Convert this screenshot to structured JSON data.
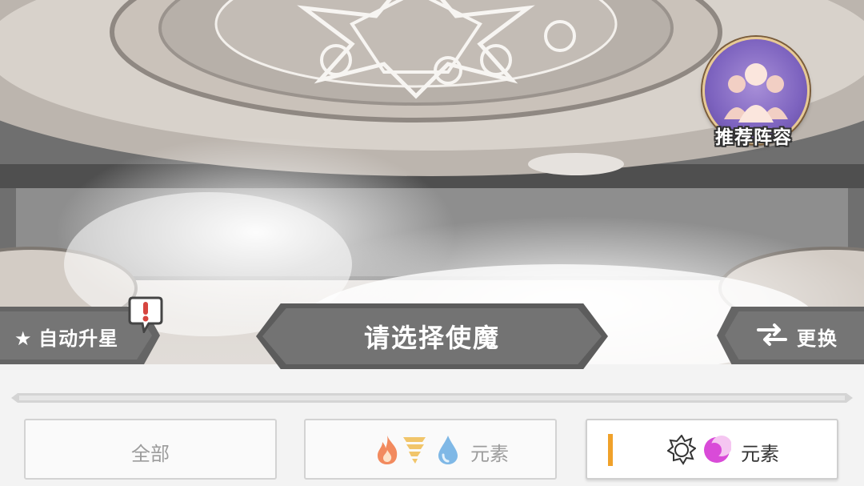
{
  "recommend": {
    "label": "推荐阵容",
    "icon": "team-silhouette-icon"
  },
  "auto_star": {
    "label": "★ 自动升星",
    "alert_icon": "exclamation-icon"
  },
  "title": {
    "label": "请选择使魔"
  },
  "swap": {
    "label": "更换",
    "icon": "swap-arrows-icon"
  },
  "filters": [
    {
      "label": "全部",
      "active": false
    },
    {
      "label": "元素",
      "icons": [
        "fire-icon",
        "wind-icon",
        "water-icon"
      ],
      "active": false
    },
    {
      "label": "元素",
      "icons": [
        "light-icon",
        "dark-icon"
      ],
      "active": true
    }
  ],
  "colors": {
    "accent_marker": "#f0a12a",
    "plate": "#757575",
    "panel": "#f3f3f3"
  }
}
